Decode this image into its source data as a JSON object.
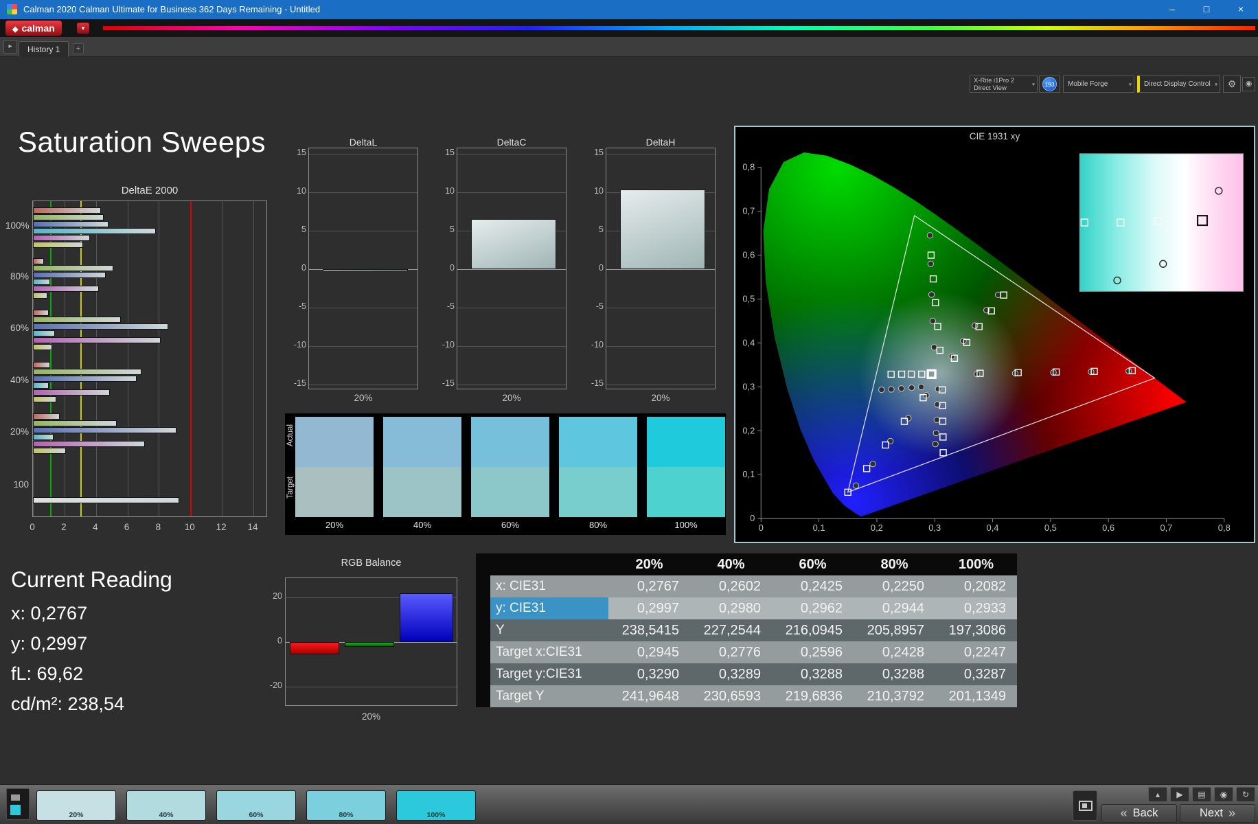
{
  "window": {
    "title": "Calman 2020 Calman Ultimate for Business 362 Days Remaining - Untitled",
    "controls": {
      "minimize": "–",
      "maximize": "□",
      "close": "×"
    }
  },
  "brand": {
    "logo_text": "calman"
  },
  "icons": {
    "logo_diamond": "◆",
    "dropdown_arrow": "▾",
    "panel_toggle": "▸",
    "gear": "⚙",
    "status": "◉",
    "back_chevrons": "«",
    "next_chevrons": "»"
  },
  "tabbar": {
    "history_tab": "History 1",
    "add_tab": "+",
    "meter_dropdown_line1": "X-Rite i1Pro 2",
    "meter_dropdown_line2": "Direct View",
    "meter_badge": "193",
    "source_dropdown": "Mobile Forge",
    "display_dropdown": "Direct Display Control"
  },
  "page": {
    "title": "Saturation Sweeps"
  },
  "current_reading": {
    "heading": "Current Reading",
    "x": "x: 0,2767",
    "y": "y: 0,2997",
    "fl": "fL: 69,62",
    "cdm2": "cd/m²: 238,54"
  },
  "swatch_strip": {
    "row_labels": [
      "Actual",
      "Target"
    ],
    "columns": [
      {
        "label": "20%",
        "actual": "#92b8d2",
        "target": "#aabfc0"
      },
      {
        "label": "40%",
        "actual": "#86bcd8",
        "target": "#9cc3c6"
      },
      {
        "label": "60%",
        "actual": "#76c0dc",
        "target": "#8cc8ca"
      },
      {
        "label": "80%",
        "actual": "#5fc6e0",
        "target": "#78cecd"
      },
      {
        "label": "100%",
        "actual": "#1ecadc",
        "target": "#4ed2d0"
      }
    ]
  },
  "table": {
    "headers": [
      "20%",
      "40%",
      "60%",
      "80%",
      "100%"
    ],
    "rows": [
      {
        "label": "x: CIE31",
        "values": [
          "0,2767",
          "0,2602",
          "0,2425",
          "0,2250",
          "0,2082"
        ]
      },
      {
        "label": "y: CIE31",
        "label_bg": "#3a93c4",
        "values": [
          "0,2997",
          "0,2980",
          "0,2962",
          "0,2944",
          "0,2933"
        ]
      },
      {
        "label": "Y",
        "values": [
          "238,5415",
          "227,2544",
          "216,0945",
          "205,8957",
          "197,3086"
        ]
      },
      {
        "label": "Target x:CIE31",
        "values": [
          "0,2945",
          "0,2776",
          "0,2596",
          "0,2428",
          "0,2247"
        ]
      },
      {
        "label": "Target y:CIE31",
        "values": [
          "0,3290",
          "0,3289",
          "0,3288",
          "0,3288",
          "0,3287"
        ]
      },
      {
        "label": "Target Y",
        "values": [
          "241,9648",
          "230,6593",
          "219,6836",
          "210,3792",
          "201,1349"
        ]
      }
    ]
  },
  "bottom_bar": {
    "back_label": "Back",
    "next_label": "Next",
    "swatches": [
      {
        "label": "20%",
        "color": "#c6e0e4"
      },
      {
        "label": "40%",
        "color": "#b2dbe0"
      },
      {
        "label": "60%",
        "color": "#9ad6df"
      },
      {
        "label": "80%",
        "color": "#7cd0dd"
      },
      {
        "label": "100%",
        "color": "#2cc8db"
      }
    ],
    "mini_buttons": [
      {
        "name": "eject-button",
        "icon": "▴"
      },
      {
        "name": "play-button",
        "icon": "▶"
      },
      {
        "name": "print-button",
        "icon": "▤"
      },
      {
        "name": "record-button",
        "icon": "◉"
      },
      {
        "name": "sync-button",
        "icon": "↻"
      }
    ]
  },
  "chart_data": [
    {
      "id": "deltaE2000",
      "type": "bar",
      "orientation": "horizontal",
      "title": "DeltaE 2000",
      "xlim": [
        0,
        14
      ],
      "xticks": [
        0,
        2,
        4,
        6,
        8,
        10,
        12,
        14
      ],
      "reference_lines": [
        {
          "value": 1.1,
          "color": "#00b000"
        },
        {
          "value": 3.0,
          "color": "#cccc00"
        },
        {
          "value": 10.0,
          "color": "#dd0000"
        }
      ],
      "groups": [
        {
          "label": "100%",
          "bars": [
            {
              "name": "red",
              "color": "#bd675e",
              "value": 4.3
            },
            {
              "name": "green",
              "color": "#96b562",
              "value": 4.5
            },
            {
              "name": "blue",
              "color": "#5a6fb2",
              "value": 4.8
            },
            {
              "name": "cyan",
              "color": "#53b7c7",
              "value": 7.8
            },
            {
              "name": "magenta",
              "color": "#b163b1",
              "value": 3.6
            },
            {
              "name": "yellow",
              "color": "#c3c364",
              "value": 3.2
            }
          ]
        },
        {
          "label": "80%",
          "bars": [
            {
              "name": "red",
              "color": "#bd675e",
              "value": 0.7
            },
            {
              "name": "green",
              "color": "#96b562",
              "value": 5.1
            },
            {
              "name": "blue",
              "color": "#5a6fb2",
              "value": 4.6
            },
            {
              "name": "cyan",
              "color": "#53b7c7",
              "value": 1.1
            },
            {
              "name": "magenta",
              "color": "#b163b1",
              "value": 4.2
            },
            {
              "name": "yellow",
              "color": "#c3c364",
              "value": 0.9
            }
          ]
        },
        {
          "label": "60%",
          "bars": [
            {
              "name": "red",
              "color": "#bd675e",
              "value": 1.0
            },
            {
              "name": "green",
              "color": "#96b562",
              "value": 5.6
            },
            {
              "name": "blue",
              "color": "#5a6fb2",
              "value": 8.6
            },
            {
              "name": "cyan",
              "color": "#53b7c7",
              "value": 1.4
            },
            {
              "name": "magenta",
              "color": "#b163b1",
              "value": 8.1
            },
            {
              "name": "yellow",
              "color": "#c3c364",
              "value": 1.2
            }
          ]
        },
        {
          "label": "40%",
          "bars": [
            {
              "name": "red",
              "color": "#bd675e",
              "value": 1.1
            },
            {
              "name": "green",
              "color": "#96b562",
              "value": 6.9
            },
            {
              "name": "blue",
              "color": "#5a6fb2",
              "value": 6.6
            },
            {
              "name": "cyan",
              "color": "#53b7c7",
              "value": 1.0
            },
            {
              "name": "magenta",
              "color": "#b163b1",
              "value": 4.9
            },
            {
              "name": "yellow",
              "color": "#c3c364",
              "value": 1.5
            }
          ]
        },
        {
          "label": "20%",
          "bars": [
            {
              "name": "red",
              "color": "#bd675e",
              "value": 1.7
            },
            {
              "name": "green",
              "color": "#96b562",
              "value": 5.3
            },
            {
              "name": "blue",
              "color": "#5a6fb2",
              "value": 9.1
            },
            {
              "name": "cyan",
              "color": "#53b7c7",
              "value": 1.3
            },
            {
              "name": "magenta",
              "color": "#b163b1",
              "value": 7.1
            },
            {
              "name": "yellow",
              "color": "#c3c364",
              "value": 2.1
            }
          ]
        },
        {
          "label": "100",
          "bars": [
            {
              "name": "white",
              "color": "#dedede",
              "value": 9.3
            }
          ]
        }
      ]
    },
    {
      "id": "deltaL",
      "type": "bar",
      "title": "DeltaL",
      "categories": [
        "20%"
      ],
      "values": [
        -0.3
      ],
      "ylim": [
        -15,
        15
      ],
      "yticks": [
        15,
        10,
        5,
        0,
        -5,
        -10,
        -15
      ]
    },
    {
      "id": "deltaC",
      "type": "bar",
      "title": "DeltaC",
      "categories": [
        "20%"
      ],
      "values": [
        6.5
      ],
      "ylim": [
        -15,
        15
      ],
      "yticks": [
        15,
        10,
        5,
        0,
        -5,
        -10,
        -15
      ]
    },
    {
      "id": "deltaH",
      "type": "bar",
      "title": "DeltaH",
      "categories": [
        "20%"
      ],
      "values": [
        10.4
      ],
      "ylim": [
        -15,
        15
      ],
      "yticks": [
        15,
        10,
        5,
        0,
        -5,
        -10,
        -15
      ]
    },
    {
      "id": "rgbBalance",
      "type": "bar",
      "title": "RGB Balance",
      "categories": [
        "20%"
      ],
      "series": [
        {
          "name": "Red",
          "color": "#ff1a1a",
          "color2": "#a80000",
          "value": -5.5
        },
        {
          "name": "Green",
          "color": "#1faf1f",
          "color2": "#006400",
          "value": -2.0
        },
        {
          "name": "Blue",
          "color": "#5a5aff",
          "color2": "#0000bb",
          "value": 22.0
        }
      ],
      "ylim": [
        -30,
        30
      ],
      "yticks": [
        20,
        0,
        -20
      ]
    },
    {
      "id": "cie1931",
      "type": "scatter",
      "title": "CIE 1931 xy",
      "xlim": [
        0,
        0.8
      ],
      "ylim": [
        0,
        0.8
      ],
      "xticks": [
        "0",
        "0,1",
        "0,2",
        "0,3",
        "0,4",
        "0,5",
        "0,6",
        "0,7",
        "0,8"
      ],
      "yticks": [
        "0",
        "0,1",
        "0,2",
        "0,3",
        "0,4",
        "0,5",
        "0,6",
        "0,7",
        "0,8"
      ],
      "gamut_triangle": [
        [
          0.68,
          0.32
        ],
        [
          0.265,
          0.69
        ],
        [
          0.15,
          0.06
        ]
      ],
      "targets": [
        [
          0.2945,
          0.329
        ],
        [
          0.2776,
          0.3289
        ],
        [
          0.2596,
          0.3288
        ],
        [
          0.2428,
          0.3288
        ],
        [
          0.2247,
          0.3287
        ],
        [
          0.3784,
          0.3308
        ],
        [
          0.4441,
          0.3323
        ],
        [
          0.5098,
          0.3338
        ],
        [
          0.5755,
          0.3353
        ],
        [
          0.6412,
          0.3368
        ],
        [
          0.3089,
          0.3832
        ],
        [
          0.3051,
          0.4374
        ],
        [
          0.3013,
          0.4916
        ],
        [
          0.2975,
          0.5458
        ],
        [
          0.2937,
          0.6
        ],
        [
          0.28,
          0.2752
        ],
        [
          0.2475,
          0.2214
        ],
        [
          0.215,
          0.1676
        ],
        [
          0.1825,
          0.1138
        ],
        [
          0.15,
          0.06
        ],
        [
          0.3131,
          0.2932
        ],
        [
          0.3135,
          0.2574
        ],
        [
          0.3139,
          0.2216
        ],
        [
          0.3143,
          0.1858
        ],
        [
          0.3147,
          0.15
        ],
        [
          0.334,
          0.365
        ],
        [
          0.3553,
          0.401
        ],
        [
          0.3766,
          0.437
        ],
        [
          0.3979,
          0.473
        ],
        [
          0.4192,
          0.509
        ]
      ],
      "measurements": [
        [
          0.2767,
          0.2997
        ],
        [
          0.2602,
          0.298
        ],
        [
          0.2425,
          0.2962
        ],
        [
          0.225,
          0.2944
        ],
        [
          0.2082,
          0.2933
        ],
        [
          0.373,
          0.329
        ],
        [
          0.439,
          0.3308
        ],
        [
          0.505,
          0.3326
        ],
        [
          0.57,
          0.3342
        ],
        [
          0.635,
          0.3358
        ],
        [
          0.299,
          0.39
        ],
        [
          0.2965,
          0.45
        ],
        [
          0.2945,
          0.51
        ],
        [
          0.293,
          0.58
        ],
        [
          0.2918,
          0.645
        ],
        [
          0.2855,
          0.2805
        ],
        [
          0.2545,
          0.2285
        ],
        [
          0.2235,
          0.1765
        ],
        [
          0.193,
          0.1245
        ],
        [
          0.164,
          0.075
        ],
        [
          0.306,
          0.295
        ],
        [
          0.3048,
          0.26
        ],
        [
          0.3036,
          0.225
        ],
        [
          0.3024,
          0.195
        ],
        [
          0.3012,
          0.17
        ],
        [
          0.3295,
          0.3695
        ],
        [
          0.3495,
          0.4045
        ],
        [
          0.3695,
          0.4395
        ],
        [
          0.3895,
          0.4745
        ],
        [
          0.4095,
          0.5095
        ]
      ],
      "current_target": [
        0.2945,
        0.329
      ],
      "inset_markers": {
        "squares": [
          [
            0.03,
            0.5
          ],
          [
            0.25,
            0.5
          ],
          [
            0.48,
            0.49
          ]
        ],
        "bold_square": [
          0.75,
          0.485
        ],
        "circles": [
          [
            0.85,
            0.27
          ],
          [
            0.51,
            0.8
          ],
          [
            0.23,
            0.92
          ]
        ]
      }
    }
  ]
}
